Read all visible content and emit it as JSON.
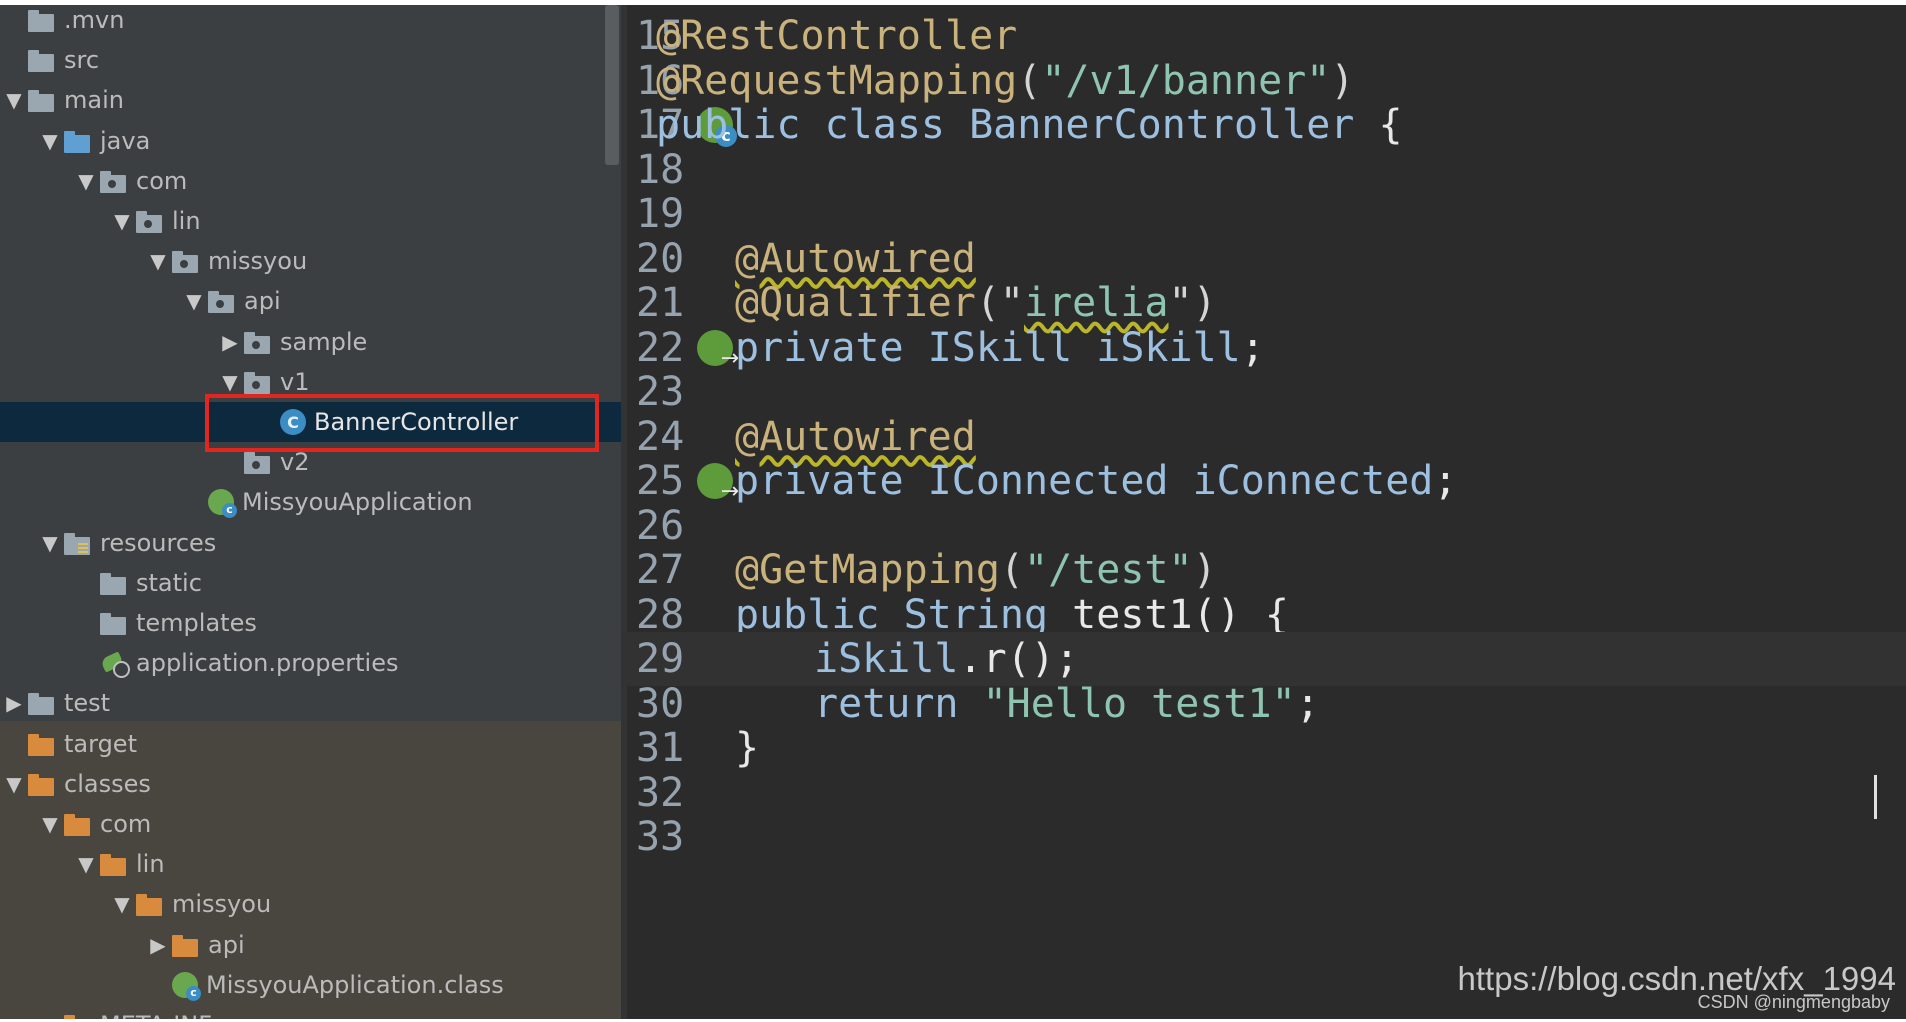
{
  "tree": {
    "items": [
      {
        "label": ".mvn",
        "level": 0,
        "arrow": "none",
        "icon": "folder-icon"
      },
      {
        "label": "src",
        "level": 0,
        "arrow": "none",
        "icon": "folder-icon"
      },
      {
        "label": "main",
        "level": 0,
        "arrow": "expanded",
        "icon": "folder-icon"
      },
      {
        "label": "java",
        "level": 1,
        "arrow": "expanded",
        "icon": "source-folder-icon"
      },
      {
        "label": "com",
        "level": 2,
        "arrow": "expanded",
        "icon": "package-icon"
      },
      {
        "label": "lin",
        "level": 3,
        "arrow": "expanded",
        "icon": "package-icon"
      },
      {
        "label": "missyou",
        "level": 4,
        "arrow": "expanded",
        "icon": "package-icon"
      },
      {
        "label": "api",
        "level": 5,
        "arrow": "expanded",
        "icon": "package-icon"
      },
      {
        "label": "sample",
        "level": 6,
        "arrow": "collapsed",
        "icon": "package-icon"
      },
      {
        "label": "v1",
        "level": 6,
        "arrow": "expanded",
        "icon": "package-icon"
      },
      {
        "label": "BannerController",
        "level": 7,
        "arrow": "none",
        "icon": "class-icon",
        "selected": true
      },
      {
        "label": "v2",
        "level": 6,
        "arrow": "none",
        "icon": "package-icon"
      },
      {
        "label": "MissyouApplication",
        "level": 5,
        "arrow": "none",
        "icon": "spring-app-icon"
      },
      {
        "label": "resources",
        "level": 1,
        "arrow": "expanded",
        "icon": "resources-folder-icon"
      },
      {
        "label": "static",
        "level": 2,
        "arrow": "none",
        "icon": "folder-icon"
      },
      {
        "label": "templates",
        "level": 2,
        "arrow": "none",
        "icon": "folder-icon"
      },
      {
        "label": "application.properties",
        "level": 2,
        "arrow": "none",
        "icon": "properties-icon"
      },
      {
        "label": "test",
        "level": 0,
        "arrow": "collapsed",
        "icon": "folder-icon"
      },
      {
        "label": "target",
        "level": 0,
        "arrow": "none",
        "icon": "output-folder-icon"
      },
      {
        "label": "classes",
        "level": 0,
        "arrow": "expanded",
        "icon": "output-folder-icon"
      },
      {
        "label": "com",
        "level": 1,
        "arrow": "expanded",
        "icon": "output-folder-icon"
      },
      {
        "label": "lin",
        "level": 2,
        "arrow": "expanded",
        "icon": "output-folder-icon"
      },
      {
        "label": "missyou",
        "level": 3,
        "arrow": "expanded",
        "icon": "output-folder-icon"
      },
      {
        "label": "api",
        "level": 4,
        "arrow": "collapsed",
        "icon": "output-folder-icon"
      },
      {
        "label": "MissyouApplication.class",
        "level": 4,
        "arrow": "none",
        "icon": "spring-app-icon"
      },
      {
        "label": "META-INF",
        "level": 1,
        "arrow": "collapsed",
        "icon": "output-folder-icon"
      }
    ]
  },
  "editor": {
    "lines": [
      {
        "number": "15",
        "tokens": [
          {
            "t": "@RestController",
            "k": "ann"
          }
        ]
      },
      {
        "number": "16",
        "tokens": [
          {
            "t": "@RequestMapping",
            "k": "ann"
          },
          {
            "t": "(",
            "k": "plain"
          },
          {
            "t": "\"/v1/banner\"",
            "k": "str"
          },
          {
            "t": ")",
            "k": "plain"
          }
        ]
      },
      {
        "number": "17",
        "gutter_icon": "spring-bean-class-icon",
        "tokens": [
          {
            "t": "public ",
            "k": "kw"
          },
          {
            "t": "class ",
            "k": "kw"
          },
          {
            "t": "BannerController ",
            "k": "type"
          },
          {
            "t": "{",
            "k": "def"
          }
        ]
      },
      {
        "number": "18",
        "tokens": []
      },
      {
        "number": "19",
        "tokens": []
      },
      {
        "number": "20",
        "indent": 1,
        "tokens": [
          {
            "t": "@Autowired",
            "k": "ann",
            "squiggle": true
          }
        ]
      },
      {
        "number": "21",
        "indent": 1,
        "tokens": [
          {
            "t": "@Qualifier",
            "k": "ann"
          },
          {
            "t": "(\"",
            "k": "plain"
          },
          {
            "t": "irelia",
            "k": "str",
            "squiggle": true
          },
          {
            "t": "\")",
            "k": "plain"
          }
        ]
      },
      {
        "number": "22",
        "gutter_icon": "spring-injection-icon",
        "indent": 1,
        "tokens": [
          {
            "t": "private ",
            "k": "kw"
          },
          {
            "t": "ISkill ",
            "k": "type"
          },
          {
            "t": "iSkill",
            "k": "fld"
          },
          {
            "t": ";",
            "k": "def"
          }
        ]
      },
      {
        "number": "23",
        "tokens": []
      },
      {
        "number": "24",
        "indent": 1,
        "tokens": [
          {
            "t": "@Autowired",
            "k": "ann",
            "squiggle": true
          }
        ]
      },
      {
        "number": "25",
        "gutter_icon": "spring-injection-icon",
        "indent": 1,
        "tokens": [
          {
            "t": "private ",
            "k": "kw"
          },
          {
            "t": "IConnected ",
            "k": "type"
          },
          {
            "t": "iConnected",
            "k": "fld"
          },
          {
            "t": ";",
            "k": "def"
          }
        ]
      },
      {
        "number": "26",
        "tokens": []
      },
      {
        "number": "27",
        "indent": 1,
        "tokens": [
          {
            "t": "@GetMapping",
            "k": "ann"
          },
          {
            "t": "(",
            "k": "plain"
          },
          {
            "t": "\"/test\"",
            "k": "str"
          },
          {
            "t": ")",
            "k": "plain"
          }
        ]
      },
      {
        "number": "28",
        "indent": 1,
        "tokens": [
          {
            "t": "public ",
            "k": "kw"
          },
          {
            "t": "String ",
            "k": "type"
          },
          {
            "t": "test1",
            "k": "def"
          },
          {
            "t": "() {",
            "k": "def"
          }
        ]
      },
      {
        "number": "29",
        "indent": 2,
        "current": true,
        "tokens": [
          {
            "t": "iSkill",
            "k": "fld"
          },
          {
            "t": ".r();",
            "k": "def"
          }
        ]
      },
      {
        "number": "30",
        "indent": 2,
        "tokens": [
          {
            "t": "return ",
            "k": "kw"
          },
          {
            "t": "\"Hello test1\"",
            "k": "str"
          },
          {
            "t": ";",
            "k": "def"
          }
        ]
      },
      {
        "number": "31",
        "indent": 1,
        "tokens": [
          {
            "t": "}",
            "k": "def"
          }
        ]
      },
      {
        "number": "32",
        "tokens": []
      },
      {
        "number": "33",
        "tokens": []
      }
    ]
  },
  "watermark": {
    "url": "https://blog.csdn.net/xfx_1994",
    "credit": "CSDN @ningmengbaby"
  }
}
